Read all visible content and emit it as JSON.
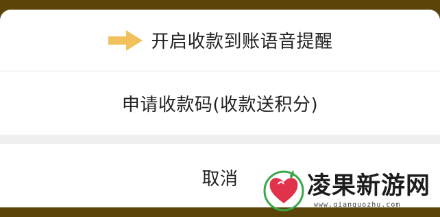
{
  "action_sheet": {
    "options": [
      {
        "label": "开启收款到账语音提醒",
        "icon": "arrow-right-icon"
      },
      {
        "label": "申请收款码(收款送积分)"
      }
    ],
    "cancel_label": "取消"
  },
  "watermark": {
    "title": "凌果新游网",
    "url": "www.qianguozhu.com"
  },
  "colors": {
    "backdrop": "#5a4408",
    "arrow": "#f2c15e",
    "sheet_bg": "#ffffff",
    "text": "#222222",
    "logo_red": "#e0334b",
    "logo_green": "#3aa64a"
  }
}
